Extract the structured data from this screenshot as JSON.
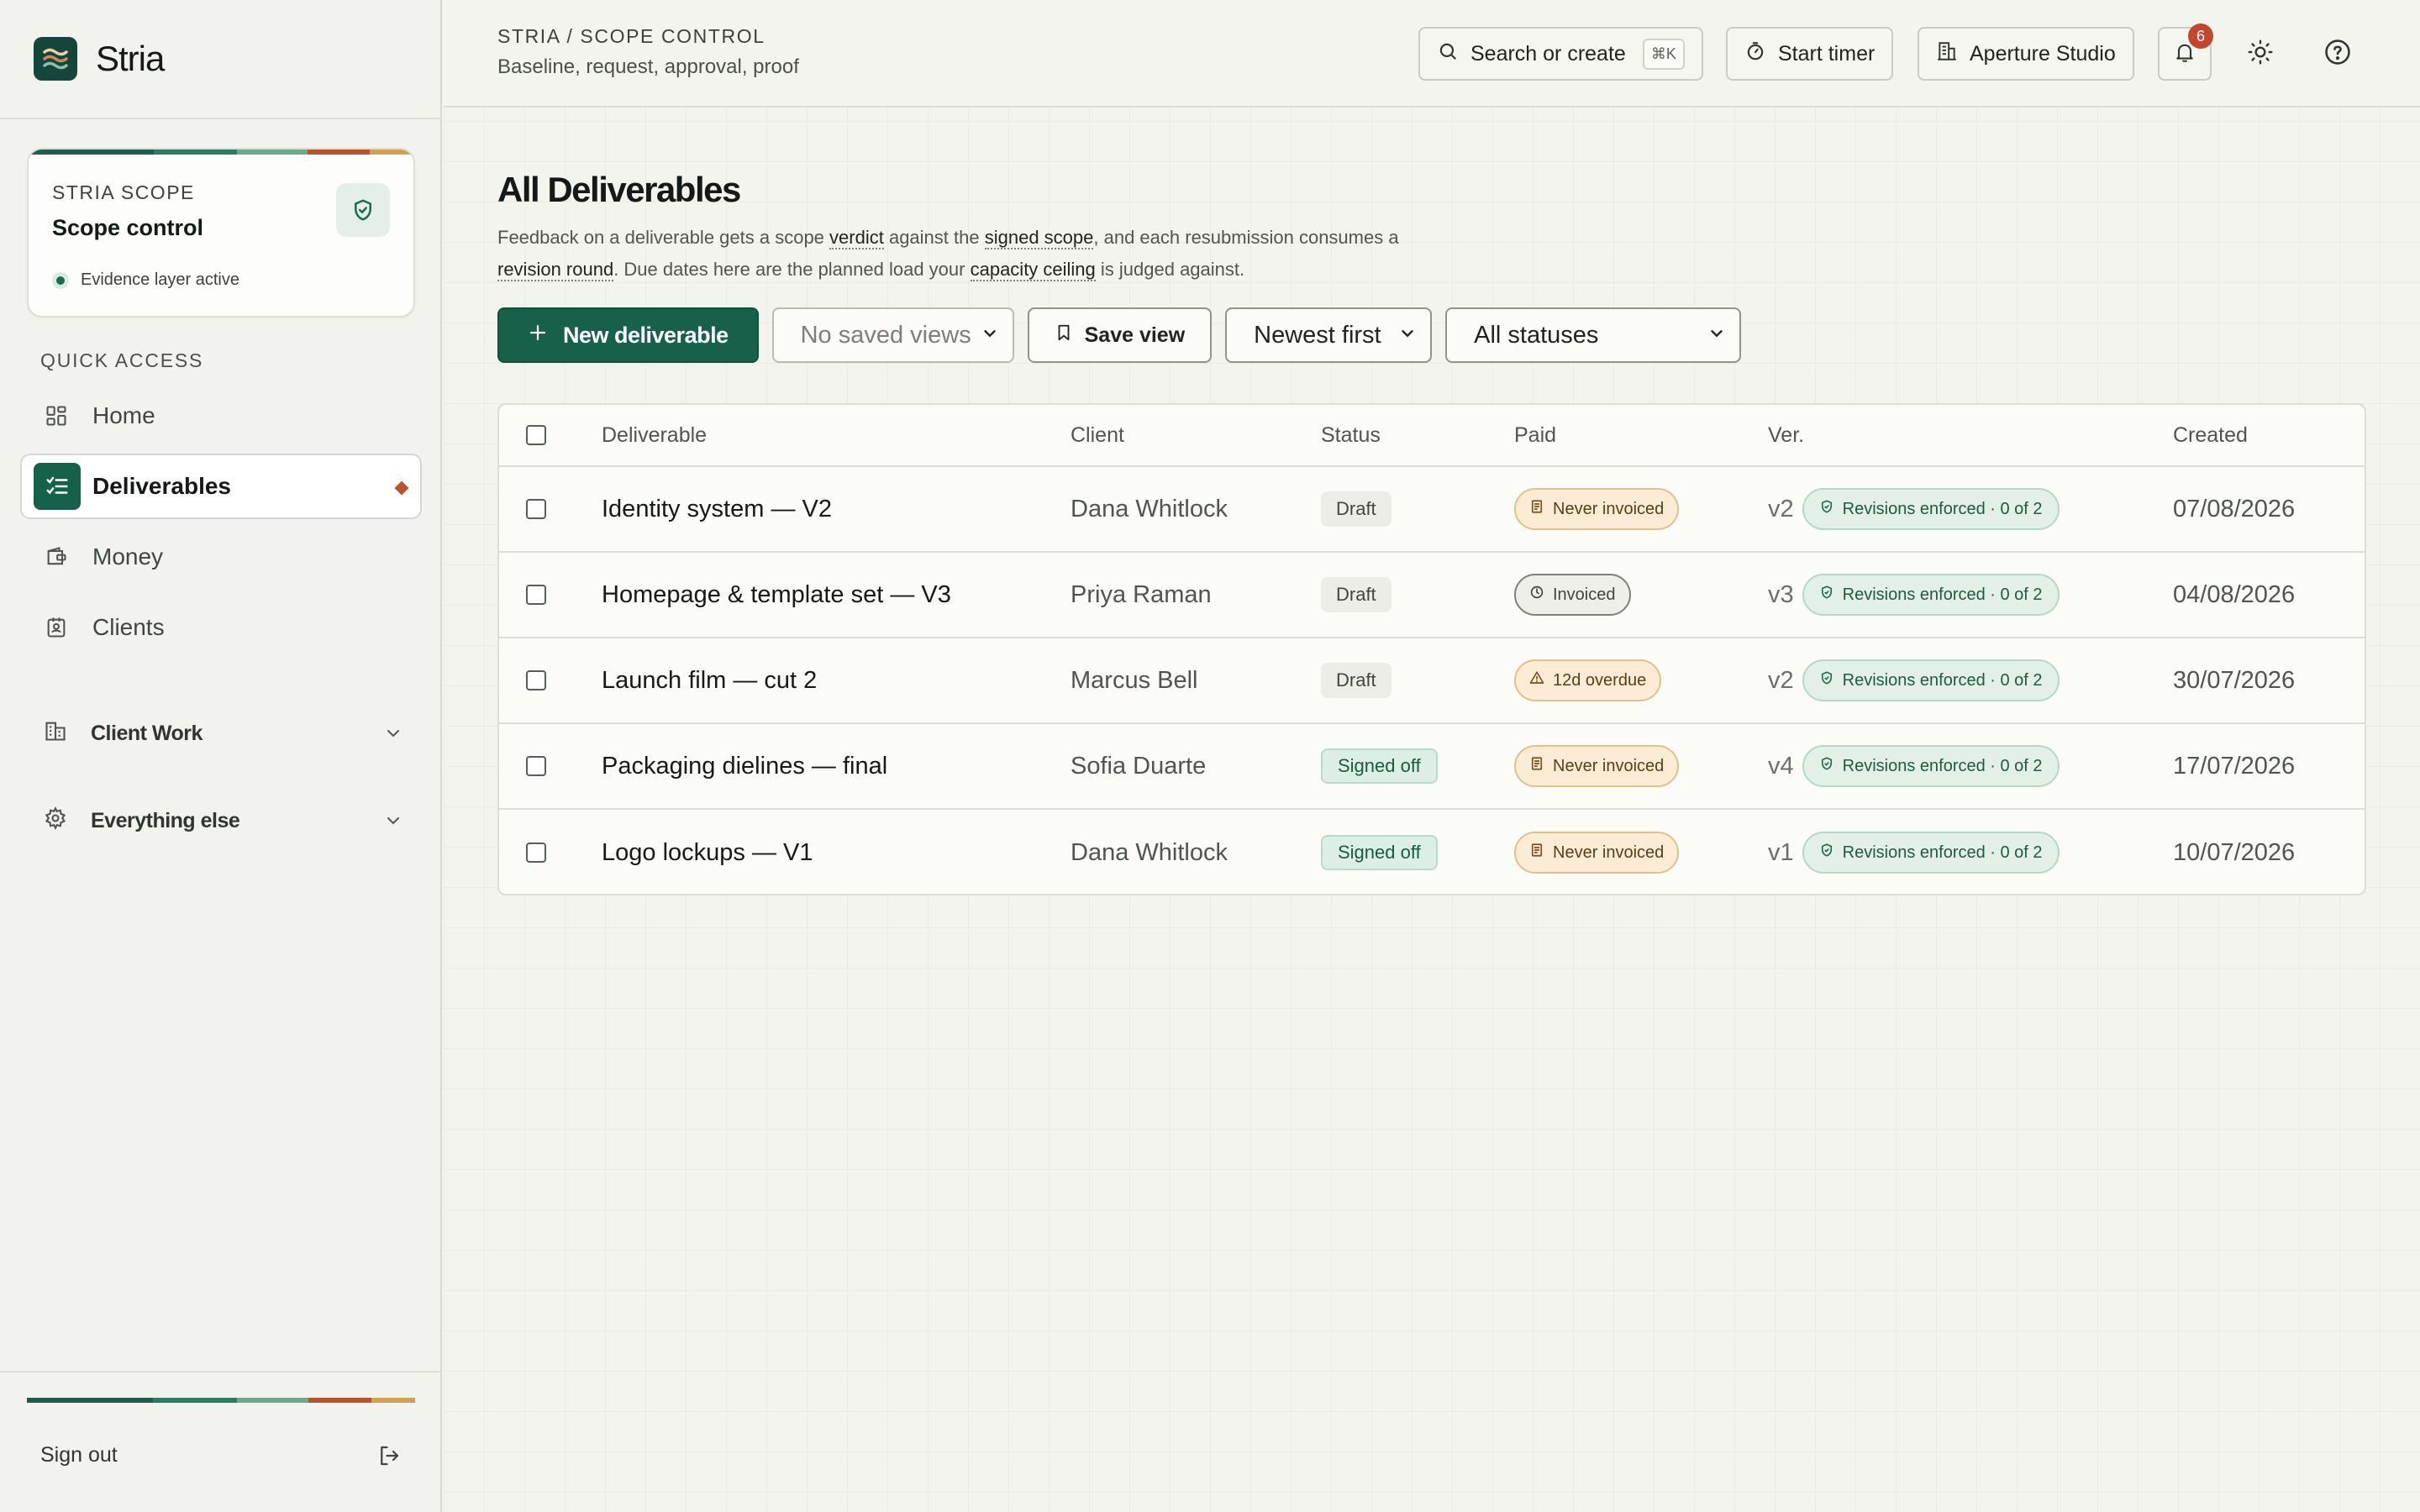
{
  "brand": {
    "name": "Stria"
  },
  "colors": {
    "accent": "#17614b",
    "stripe": [
      "#1f5d4e",
      "#2f7a62",
      "#6fa88c",
      "#b8532b",
      "#d2a04e"
    ]
  },
  "scope_card": {
    "kicker": "STRIA SCOPE",
    "title": "Scope control",
    "status": "Evidence layer active",
    "icon": "shield-check-icon"
  },
  "sidebar": {
    "quick_access_heading": "QUICK ACCESS",
    "items": [
      {
        "label": "Home",
        "icon": "grid-icon"
      },
      {
        "label": "Deliverables",
        "icon": "checklist-icon"
      },
      {
        "label": "Money",
        "icon": "wallet-icon"
      },
      {
        "label": "Clients",
        "icon": "contact-icon"
      }
    ],
    "groups": [
      {
        "label": "Client Work",
        "icon": "building-icon"
      },
      {
        "label": "Everything else",
        "icon": "gear-icon"
      }
    ],
    "sign_out": "Sign out"
  },
  "topbar": {
    "breadcrumb": "STRIA / SCOPE CONTROL",
    "subtitle": "Baseline, request, approval, proof",
    "search_label": "Search or create",
    "search_shortcut": "⌘K",
    "timer_label": "Start timer",
    "workspace_label": "Aperture Studio",
    "notification_count": "6"
  },
  "page": {
    "title": "All Deliverables",
    "desc": {
      "p1": "Feedback on a deliverable gets a scope ",
      "t1": "verdict",
      "p2": " against the ",
      "t2": "signed scope",
      "p3": ", and each resubmission consumes a ",
      "t3": "revision round",
      "p4": ". Due dates here are the planned load your ",
      "t4": "capacity ceiling",
      "p5": " is judged against."
    }
  },
  "toolbar": {
    "new_label": "New deliverable",
    "saved_views": "No saved views",
    "save_view_label": "Save view",
    "sort": "Newest first",
    "status_filter": "All statuses"
  },
  "table": {
    "headers": {
      "deliverable": "Deliverable",
      "client": "Client",
      "status": "Status",
      "paid": "Paid",
      "version": "Ver.",
      "created": "Created"
    },
    "rows": [
      {
        "deliverable": "Identity system — V2",
        "client": "Dana Whitlock",
        "status": "Draft",
        "paid": "Never invoiced",
        "version": "v2",
        "revisions": "Revisions enforced · 0 of 2",
        "created": "07/08/2026"
      },
      {
        "deliverable": "Homepage & template set — V3",
        "client": "Priya Raman",
        "status": "Draft",
        "paid": "Invoiced",
        "version": "v3",
        "revisions": "Revisions enforced · 0 of 2",
        "created": "04/08/2026"
      },
      {
        "deliverable": "Launch film — cut 2",
        "client": "Marcus Bell",
        "status": "Draft",
        "paid": "12d overdue",
        "version": "v2",
        "revisions": "Revisions enforced · 0 of 2",
        "created": "30/07/2026"
      },
      {
        "deliverable": "Packaging dielines — final",
        "client": "Sofia Duarte",
        "status": "Signed off",
        "paid": "Never invoiced",
        "version": "v4",
        "revisions": "Revisions enforced · 0 of 2",
        "created": "17/07/2026"
      },
      {
        "deliverable": "Logo lockups — V1",
        "client": "Dana Whitlock",
        "status": "Signed off",
        "paid": "Never invoiced",
        "version": "v1",
        "revisions": "Revisions enforced · 0 of 2",
        "created": "10/07/2026"
      }
    ]
  }
}
